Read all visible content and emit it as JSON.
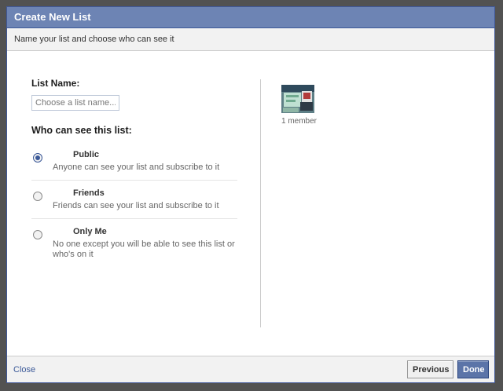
{
  "dialog": {
    "title": "Create New List",
    "subtitle": "Name your list and choose who can see it"
  },
  "form": {
    "list_name_label": "List Name:",
    "list_name_value": "",
    "list_name_placeholder": "Choose a list name...",
    "visibility_label": "Who can see this list:",
    "options": [
      {
        "title": "Public",
        "description": "Anyone can see your list and subscribe to it",
        "checked": true
      },
      {
        "title": "Friends",
        "description": "Friends can see your list and subscribe to it",
        "checked": false
      },
      {
        "title": "Only Me",
        "description": "No one except you will be able to see this list or who's on it",
        "checked": false
      }
    ]
  },
  "members": {
    "count_text": "1 member",
    "avatar_icon": "member-avatar-icon"
  },
  "footer": {
    "close_label": "Close",
    "previous_label": "Previous",
    "done_label": "Done"
  },
  "colors": {
    "titlebar": "#6d84b4",
    "accent": "#3b5998",
    "done_button": "#5b74a8"
  }
}
